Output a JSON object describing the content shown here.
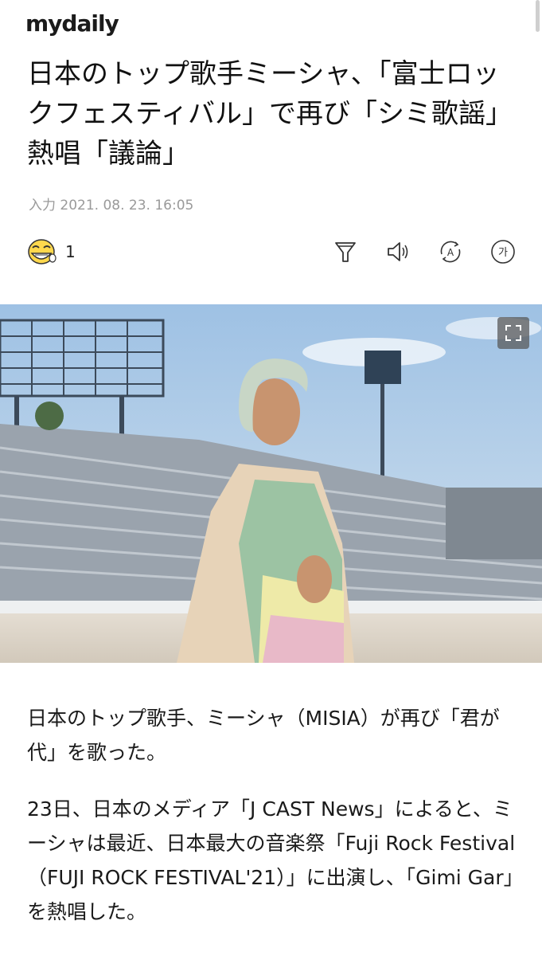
{
  "header": {
    "logo": "mydaily"
  },
  "article": {
    "title": "日本のトップ歌手ミーシャ、「富士ロックフェスティバル」で再び「シミ歌謡」熱唱「議論」",
    "date": "入力 2021. 08. 23. 16:05",
    "reaction_count": "1",
    "paragraphs": [
      "日本のトップ歌手、ミーシャ（MISIA）が再び「君が代」を歌った。",
      "23日、日本のメディア「J CAST News」によると、ミーシャは最近、日本最大の音楽祭「Fuji Rock Festival（FUJI ROCK FESTIVAL'21）」に出演し、「Gimi Gar」を熱唱した。"
    ]
  },
  "toolbar": {
    "reaction_icon": "laughing-emoji-icon",
    "tools": [
      {
        "name": "summary-filter-icon"
      },
      {
        "name": "text-to-speech-icon"
      },
      {
        "name": "translate-icon",
        "label": "A"
      },
      {
        "name": "font-size-icon",
        "label": "가"
      }
    ]
  },
  "colors": {
    "text": "#111111",
    "muted": "#9a9a9a",
    "sky": "#a9c8e6",
    "ground": "#dcd6cc"
  }
}
